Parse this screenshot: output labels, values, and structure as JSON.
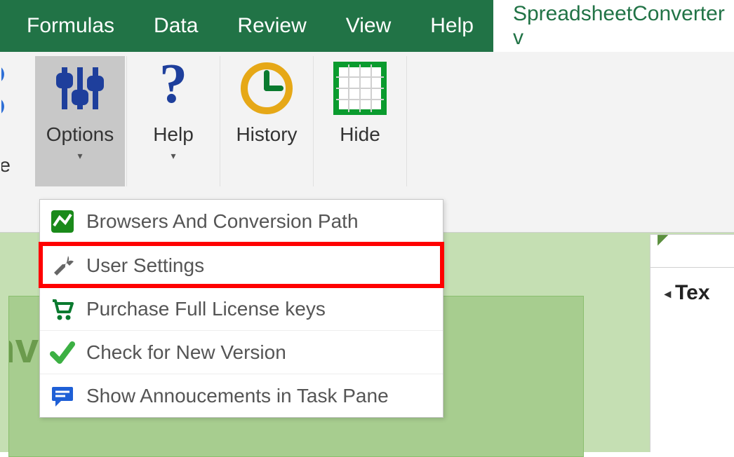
{
  "tabs": {
    "formulas": "Formulas",
    "data": "Data",
    "review": "Review",
    "view": "View",
    "help": "Help",
    "ssc": "SpreadsheetConverter v"
  },
  "ribbon": {
    "left_partial_label": "re",
    "options": "Options",
    "help": "Help",
    "history": "History",
    "hide": "Hide"
  },
  "options_menu": {
    "browsers": "Browsers And Conversion Path",
    "user_settings": "User Settings",
    "purchase": "Purchase Full License keys",
    "check_version": "Check for New Version",
    "announcements": "Show Annoucements in Task Pane"
  },
  "sheet": {
    "partial_text": "nv"
  },
  "right_pane": {
    "label": "Tex"
  }
}
